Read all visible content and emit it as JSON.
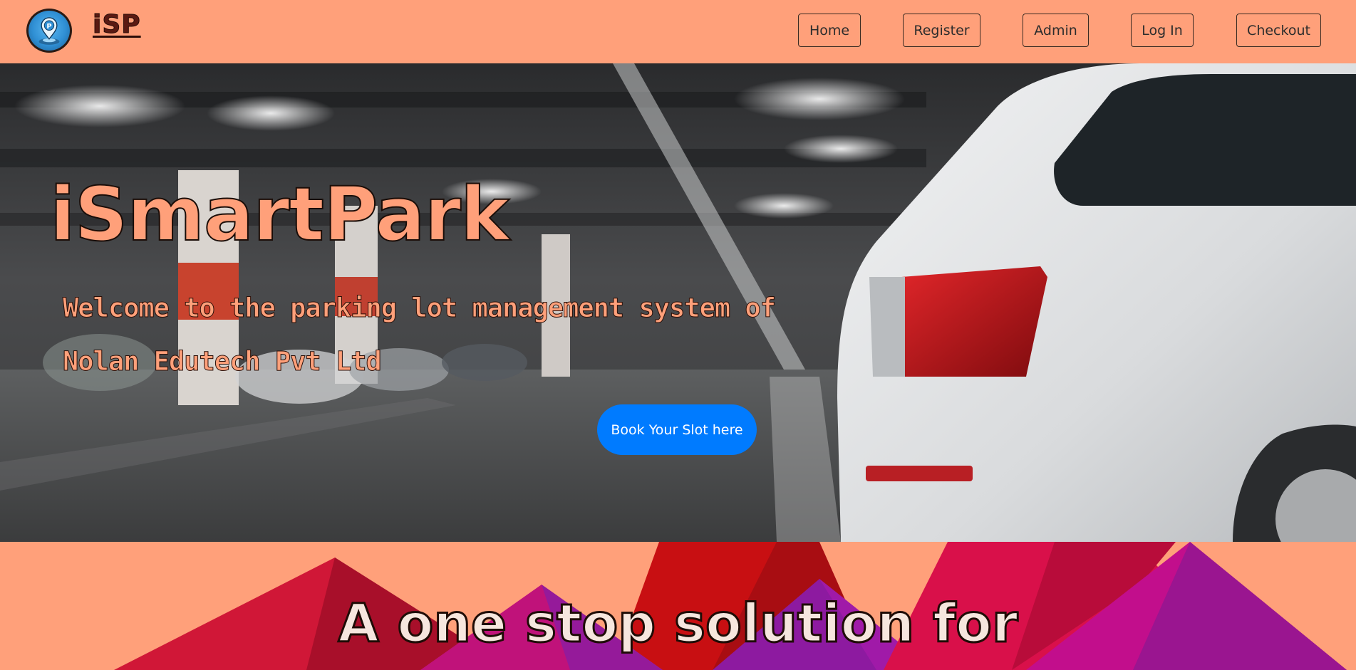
{
  "navbar": {
    "logo_icon": "parking-location-pin-icon",
    "brand": "iSP",
    "links": {
      "home": "Home",
      "register": "Register",
      "admin": "Admin",
      "login": "Log In",
      "checkout": "Checkout"
    }
  },
  "hero": {
    "title": "iSmartPark",
    "subtitle": "Welcome to the parking lot management system of Nolan Edutech Pvt Ltd",
    "cta_label": "Book Your Slot here"
  },
  "lower": {
    "heading": "A one stop solution for"
  },
  "colors": {
    "background": "#FFA07A",
    "brand_text": "#5a1a12",
    "cta": "#007bff",
    "cta_text": "#ffffff"
  }
}
